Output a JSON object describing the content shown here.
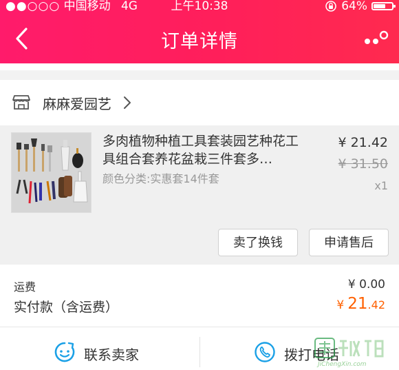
{
  "status_bar": {
    "signal_dots": "●●○○○",
    "carrier": "中国移动",
    "network": "4G",
    "time": "上午10:38",
    "battery": "64%",
    "battery_level": 0.64
  },
  "nav": {
    "title": "订单详情",
    "back_icon": "chevron-left-icon",
    "more_icon": "more-dots-icon"
  },
  "shop": {
    "name": "麻麻爱园艺",
    "icon": "store-icon"
  },
  "product": {
    "name": "多肉植物种植工具套装园艺种花工具组合套养花盆栽三件套多…",
    "spec": "颜色分类:实惠套14件套",
    "price": "¥ 21.42",
    "original_price": "¥ 31.50",
    "quantity": "x1",
    "buttons": {
      "sell": "卖了换钱",
      "after_sales": "申请售后"
    }
  },
  "totals": {
    "shipping_label": "运费",
    "shipping_value": "¥ 0.00",
    "paid_label": "实付款（含运费）",
    "paid_currency": "¥",
    "paid_integer": "21",
    "paid_decimal": ".42"
  },
  "actions": {
    "contact_label": "联系卖家",
    "call_label": "拨打电话"
  },
  "watermark": {
    "text": "JiChengXin.com"
  },
  "colors": {
    "header_start": "#ff1b6b",
    "header_end": "#ff2a4f",
    "accent_orange": "#ff6000",
    "icon_blue": "#1aa0e6"
  }
}
